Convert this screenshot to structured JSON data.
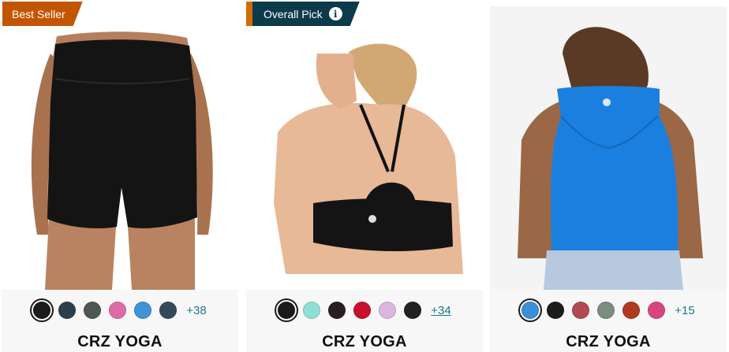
{
  "products": [
    {
      "badge": "Best Seller",
      "brand": "CRZ YOGA",
      "more_colors": "+38",
      "image_icon": "black-shorts-image",
      "swatches": [
        "#1b1b1b",
        "#2d3e4c",
        "#4e5753",
        "#e06aa6",
        "#3f93d8",
        "#344a5a"
      ]
    },
    {
      "badge": "Overall Pick",
      "brand": "CRZ YOGA",
      "more_colors": "+34",
      "image_icon": "sports-bra-image",
      "swatches": [
        "#1a1a1a",
        "#8ee0d4",
        "#2a1e22",
        "#c8102e",
        "#dcb6e0",
        "#222222"
      ]
    },
    {
      "badge": "",
      "brand": "CRZ YOGA",
      "more_colors": "+15",
      "image_icon": "blue-tank-top-image",
      "swatches": [
        "#3a8fd8",
        "#1c1c1c",
        "#b24a52",
        "#7b8c80",
        "#b03a1f",
        "#d9457f"
      ]
    }
  ],
  "colors": {
    "best_seller": "#c45500",
    "overall_pick": "#0b3b4a",
    "link": "#1a7a8a"
  }
}
